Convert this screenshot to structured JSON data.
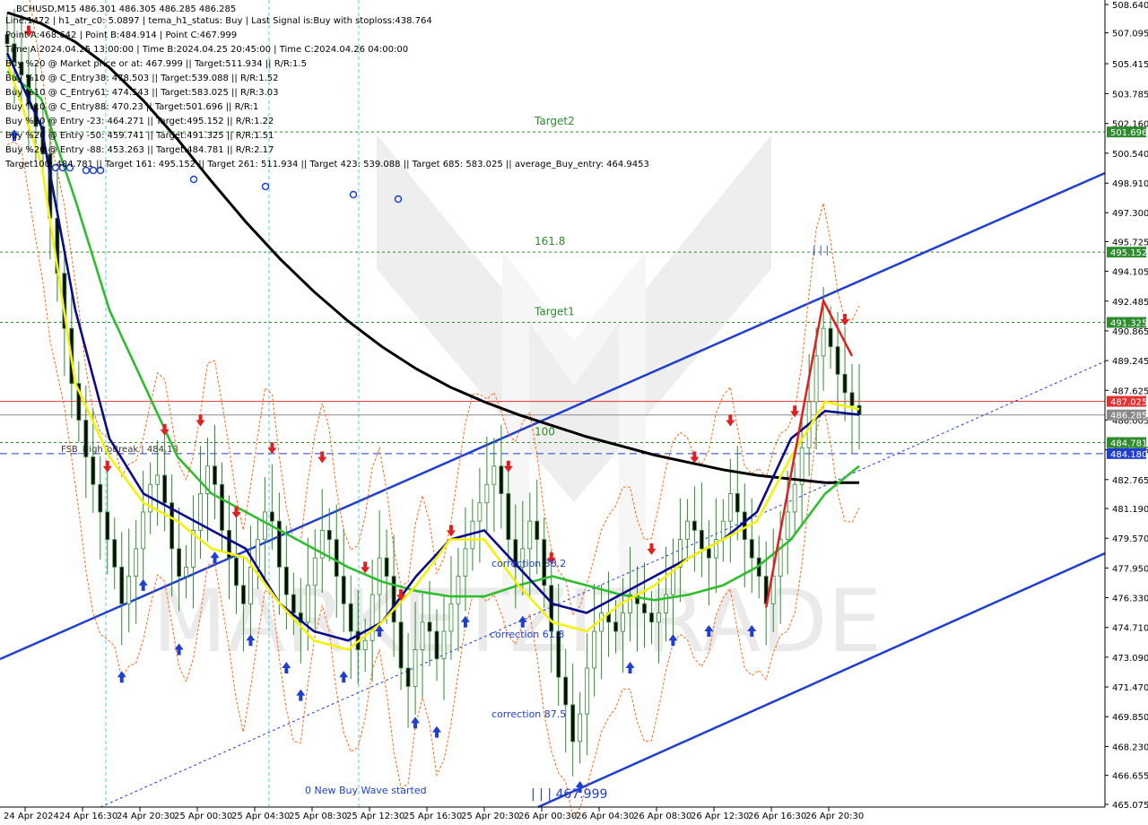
{
  "chart_data": {
    "type": "line",
    "symbol_line": "BCHUSD,M15  486.301 486.305 486.285 486.285",
    "info_lines": [
      "Line:1472 | h1_atr_c0: 5.0897 | tema_h1_status: Buy | Last Signal is:Buy with stoploss:438.764",
      "Point A:468.642 | Point B:484.914 | Point C:467.999",
      "Time A:2024.04.25 13:00:00 | Time B:2024.04.25 20:45:00 | Time C:2024.04.26 04:00:00",
      "Buy %20 @ Market price or at: 467.999 || Target:511.934 || R/R:1.5",
      "Buy %10 @ C_Entry38: 478.503 || Target:539.088 || R/R:1.52",
      "Buy %10 @ C_Entry61: 474.543 || Target:583.025 || R/R:3.03",
      "Buy %10 @ C_Entry88: 470.23 || Target:501.696 || R/R:1",
      "Buy %10 @ Entry -23: 464.271 || Target:495.152 || R/R:1.22",
      "Buy %20 @ Entry -50: 459.741 || Target:491.325 || R/R:1.51",
      "Buy %20 @ Entry -88: 453.263 || Target:484.781 || R/R:2.17",
      "Target100: 484.781 || Target 161: 495.152 || Target 261: 511.934 || Target 423: 539.088 || Target 685: 583.025 || average_Buy_entry: 464.9453"
    ],
    "y_axis": {
      "min": 465.075,
      "max": 508.64,
      "ticks": [
        "508.640",
        "507.095",
        "505.415",
        "503.785",
        "502.160",
        "500.540",
        "498.910",
        "497.300",
        "495.725",
        "494.105",
        "492.485",
        "490.865",
        "489.245",
        "487.625",
        "486.005",
        "484.385",
        "482.765",
        "481.190",
        "479.570",
        "477.950",
        "476.330",
        "474.710",
        "473.090",
        "471.470",
        "469.850",
        "468.230",
        "466.655",
        "465.075"
      ]
    },
    "x_axis": {
      "ticks": [
        "24 Apr 2024",
        "24 Apr 16:30",
        "24 Apr 20:30",
        "25 Apr 00:30",
        "25 Apr 04:30",
        "25 Apr 08:30",
        "25 Apr 12:30",
        "25 Apr 16:30",
        "25 Apr 20:30",
        "26 Apr 00:30",
        "26 Apr 04:30",
        "26 Apr 08:30",
        "26 Apr 12:30",
        "26 Apr 16:30",
        "26 Apr 20:30"
      ]
    },
    "levels": [
      {
        "label": "Target2",
        "value": 501.696,
        "badge": "501.696",
        "color": "#2e8b2e",
        "style": "dotted",
        "text_at": 0.5
      },
      {
        "label": "161.8",
        "value": 495.152,
        "badge": "495.152",
        "color": "#2e8b2e",
        "style": "dotted",
        "text_at": 0.5
      },
      {
        "label": "Target1",
        "value": 491.325,
        "badge": "491.325",
        "color": "#2e8b2e",
        "style": "dotted",
        "text_at": 0.5
      },
      {
        "label": "",
        "value": 487.025,
        "badge": "487.025",
        "color": "#e03030",
        "style": "solid",
        "text_at": 0.5
      },
      {
        "label": "",
        "value": 486.285,
        "badge": "486.285",
        "color": "#888888",
        "style": "solid",
        "text_at": 0.5
      },
      {
        "label": "100",
        "value": 484.781,
        "badge": "484.781",
        "color": "#2e8b2e",
        "style": "dotted",
        "text_at": 0.5
      },
      {
        "label": "FSB_HighToBreak | 484.18",
        "value": 484.18,
        "badge": "484.180",
        "color": "#1f3fcf",
        "style": "dashed",
        "text_at": 0.08
      }
    ],
    "annotations": [
      {
        "text": "correction 38.2",
        "x": "25 Apr 22:30",
        "y": 478.503,
        "color": "#1f3fcf"
      },
      {
        "text": "correction 61.8",
        "x": "25 Apr 22:30",
        "y": 474.543,
        "color": "#1f3fcf"
      },
      {
        "text": "correction 87.5",
        "x": "25 Apr 22:30",
        "y": 470.23,
        "color": "#1f3fcf"
      },
      {
        "text": "0 New Buy Wave started",
        "x": "25 Apr 10:30",
        "y": 465.9,
        "color": "#1f3fcf"
      },
      {
        "text": "| | | 467.999",
        "x": "26 Apr 02:00",
        "y": 465.4,
        "color": "#1f3fcf"
      },
      {
        "text": "| | |",
        "x": "26 Apr 21:30",
        "y": 495.6,
        "color": "#1f3fcf"
      }
    ],
    "series": [
      {
        "name": "",
        "color": "#000000",
        "values": [
          508.2,
          507.6,
          506.6,
          505.2,
          503.4,
          501.3,
          499.0,
          496.8,
          494.8,
          493.0,
          491.4,
          490.0,
          488.8,
          487.8,
          487.0,
          486.3,
          485.7,
          485.1,
          484.6,
          484.1,
          483.7,
          483.3,
          483.0,
          482.8,
          482.6,
          482.6
        ]
      },
      {
        "name": "",
        "color": "#2ebd2e",
        "values": [
          505.0,
          503.5,
          498.0,
          492.0,
          488.0,
          484.0,
          482.0,
          481.0,
          480.0,
          479.0,
          478.0,
          477.2,
          476.7,
          476.4,
          476.4,
          477.0,
          477.5,
          477.0,
          476.5,
          476.2,
          476.5,
          477.0,
          478.0,
          479.5,
          482.0,
          483.5
        ]
      },
      {
        "name": "",
        "color": "#0a0a8a",
        "values": [
          506.0,
          502.0,
          492.0,
          485.0,
          482.0,
          481.0,
          480.0,
          479.0,
          476.0,
          474.5,
          474.0,
          475.0,
          477.5,
          479.5,
          480.0,
          478.0,
          476.0,
          475.5,
          476.5,
          477.5,
          478.5,
          479.5,
          481.0,
          485.0,
          486.5,
          486.3
        ]
      },
      {
        "name": "",
        "color": "#f2f20a",
        "values": [
          505.5,
          500.0,
          488.0,
          484.0,
          481.5,
          480.5,
          479.0,
          478.5,
          476.0,
          474.0,
          473.5,
          475.0,
          477.0,
          479.5,
          479.5,
          477.0,
          475.0,
          474.5,
          476.0,
          477.0,
          478.5,
          479.5,
          480.5,
          484.0,
          487.0,
          486.6
        ]
      }
    ],
    "candles_close": [
      506.5,
      505.5,
      504.8,
      503.2,
      502.0,
      500.5,
      497.0,
      494.0,
      491.0,
      488.0,
      486.0,
      484.0,
      482.5,
      481.0,
      479.5,
      478.0,
      476.0,
      477.5,
      479.0,
      481.0,
      482.5,
      483.0,
      481.5,
      479.0,
      477.5,
      478.0,
      480.0,
      482.0,
      483.5,
      482.5,
      480.0,
      478.5,
      477.0,
      476.0,
      478.0,
      479.5,
      481.0,
      480.5,
      478.0,
      476.5,
      475.5,
      475.0,
      477.0,
      478.5,
      480.0,
      479.5,
      477.5,
      476.0,
      474.5,
      473.5,
      474.0,
      476.5,
      478.5,
      477.5,
      475.0,
      472.5,
      471.5,
      473.5,
      475.0,
      474.5,
      473.0,
      474.5,
      476.0,
      477.5,
      479.0,
      480.5,
      481.5,
      482.5,
      483.5,
      482.0,
      479.5,
      478.0,
      479.0,
      480.5,
      479.5,
      477.0,
      474.5,
      472.0,
      470.5,
      468.5,
      470.0,
      472.5,
      474.5,
      475.5,
      475.0,
      474.5,
      475.5,
      476.5,
      476.0,
      475.5,
      475.0,
      475.5,
      476.5,
      478.0,
      479.5,
      480.5,
      480.0,
      479.0,
      478.5,
      479.5,
      480.5,
      482.0,
      481.0,
      479.5,
      478.5,
      477.5,
      476.0,
      477.5,
      479.5,
      481.0,
      482.5,
      484.5,
      487.0,
      489.5,
      491.0,
      490.0,
      488.5,
      487.5,
      486.8,
      486.3
    ],
    "colors": {
      "background": "#ffffff",
      "up_candle": "#2e8b2e",
      "down_candle": "#2e8b2e",
      "channel": "#1f3fcf",
      "envelope": "#ff6a1a",
      "buy_arrow": "#1f3fcf",
      "sell_arrow": "#e02020",
      "watermark": "#d4d4d4"
    },
    "watermark_text": "MARKETZITRADE"
  }
}
